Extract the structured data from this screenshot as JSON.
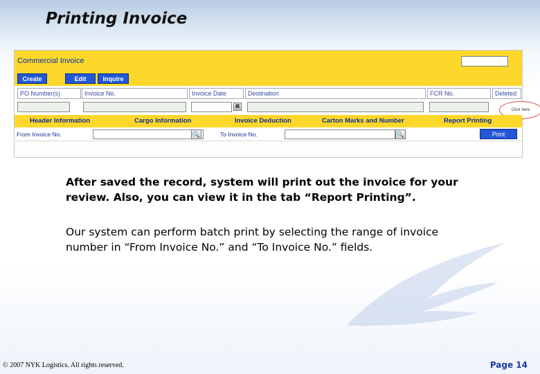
{
  "slide": {
    "title": "Printing Invoice",
    "paragraph1": "After saved the record, system will print out the invoice for your review.  Also, you can view it in the tab “Report Printing”.",
    "paragraph2": "Our system can perform batch print by selecting the range of invoice number in “From Invoice No.” and “To Invoice No.” fields.",
    "footer": "© 2007 NYK Logistics. All rights reserved.",
    "page": "Page  14"
  },
  "app": {
    "title": "Commercial Invoice",
    "toolbar": {
      "create": "Create",
      "edit": "Edit",
      "inquire": "Inquire"
    },
    "fields": {
      "po_number": "PO Number(s)",
      "invoice_no": "Invoice No.",
      "invoice_date": "Invoice Date",
      "destination": "Destination",
      "fcr_no": "FCR No.",
      "deleted": "Deleted"
    },
    "tabs": {
      "header_information": "Header Information",
      "cargo_information": "Cargo Information",
      "invoice_deduction": "Invoice Deduction",
      "carton_marks": "Carton Marks and Number",
      "report_printing": "Report Printing"
    },
    "print_row": {
      "from_label": "From Invoice No.",
      "to_label": "To Invoice No.",
      "print_button": "Print"
    },
    "callout": "Click here"
  },
  "colors": {
    "header_yellow": "#fdd82b",
    "button_blue": "#2357d6",
    "label_blue": "#0f2a96"
  }
}
